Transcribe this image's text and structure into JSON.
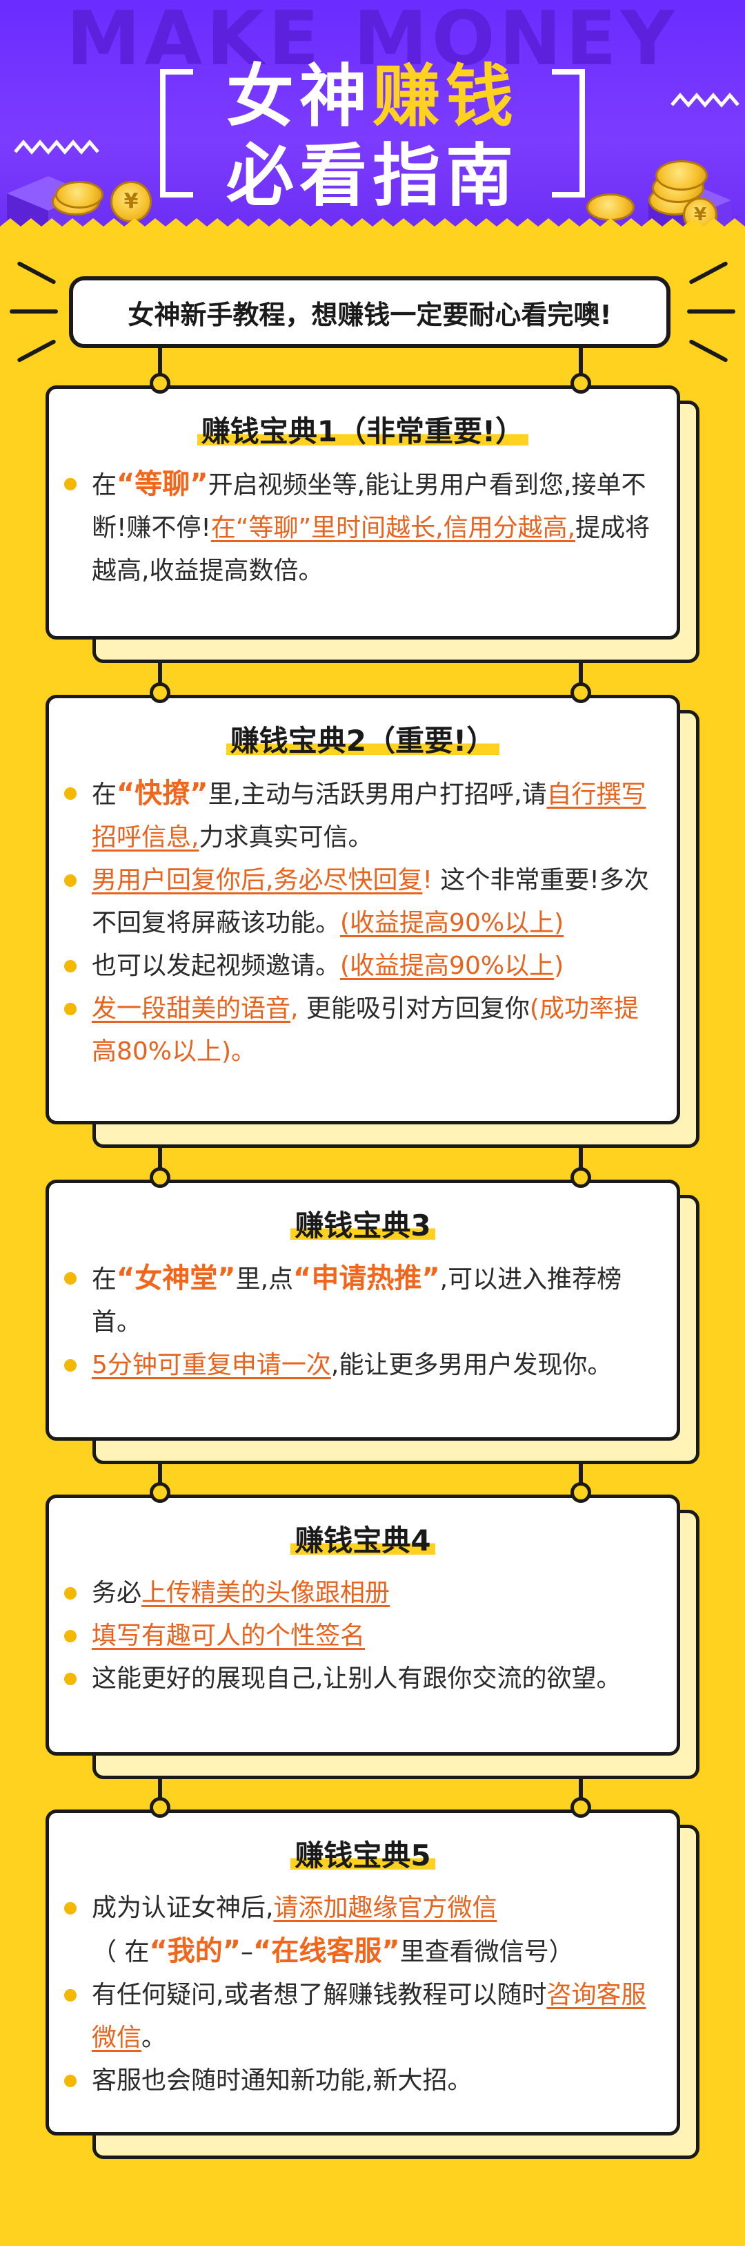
{
  "header": {
    "watermark": "MAKE MONEY",
    "title_line1_a": "女神",
    "title_line1_b": "赚钱",
    "title_line2": "必看指南",
    "coin_symbol": "¥"
  },
  "tagline": "女神新手教程，想赚钱一定要耐心看完噢!",
  "cards": [
    {
      "title": "赚钱宝典1（非常重要!）",
      "items": [
        {
          "p1": "在",
          "q": "“等聊”",
          "p2": "开启视频坐等,能让男用户看到您,接单不断!赚不停!",
          "u": "在“等聊”里时间越长,信用分越高,",
          "p3": "提成将越高,收益提高数倍。"
        }
      ]
    },
    {
      "title": "赚钱宝典2（重要!）",
      "items": [
        {
          "p1": "在",
          "q": "“快撩”",
          "p2": "里,主动与活跃男用户打招呼,请",
          "u": "自行撰写招呼信息,",
          "p3": "力求真实可信。"
        },
        {
          "u": "男用户回复你后,务必尽快回复",
          "o": "!",
          "p2": " 这个非常重要!多次不回复将屏蔽该功能。",
          "u2": "(收益提高90%以上)"
        },
        {
          "p1": "也可以发起视频邀请。",
          "u": "(收益提高90%以上",
          "o": ")"
        },
        {
          "u": "发一段甜美的语音",
          "o": ",",
          "p2": "  更能吸引对方回复你",
          "o2": "(成功率提高80%以上)。"
        }
      ]
    },
    {
      "title": "赚钱宝典3",
      "items": [
        {
          "p1": "在",
          "q": "“女神堂”",
          "p2": "里,点",
          "q2": "“申请热推”",
          "p3": ",可以进入推荐榜首。"
        },
        {
          "u": "5分钟可重复申请一次",
          "p2": ",能让更多男用户发现你。"
        }
      ]
    },
    {
      "title": "赚钱宝典4",
      "items": [
        {
          "p1": "务必",
          "u": "上传精美的头像跟相册"
        },
        {
          "u": "填写有趣可人的个性签名"
        },
        {
          "p1": "这能更好的展现自己,让别人有跟你交流的欲望。"
        }
      ]
    },
    {
      "title": "赚钱宝典5",
      "items": [
        {
          "p1": "成为认证女神后,",
          "u": "请添加趣缘官方微信"
        },
        {
          "p1": "（ 在",
          "q": "“我的”",
          "p2": "–",
          "q2": "“在线客服”",
          "p3": "里查看微信号）"
        },
        {
          "p1": "有任何疑问,或者想了解赚钱教程可以随时",
          "u": "咨询客服微信",
          "p3": "。"
        },
        {
          "p1": "客服也会随时通知新功能,新大招。"
        }
      ]
    }
  ],
  "colors": {
    "background": "#ffd21f",
    "header": "#7c3cff",
    "accent": "#f2661c",
    "bullet": "#f5b800"
  }
}
